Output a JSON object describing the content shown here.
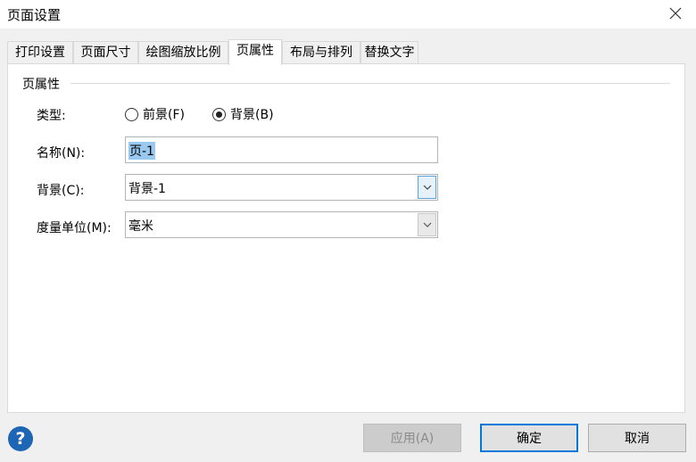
{
  "window": {
    "title": "页面设置"
  },
  "tabs": [
    {
      "label": "打印设置"
    },
    {
      "label": "页面尺寸"
    },
    {
      "label": "绘图缩放比例"
    },
    {
      "label": "页属性",
      "active": true
    },
    {
      "label": "布局与排列"
    },
    {
      "label": "替换文字"
    }
  ],
  "page_props": {
    "group_title": "页属性",
    "type": {
      "label": "类型:",
      "options": [
        {
          "label": "前景(F)",
          "selected": false
        },
        {
          "label": "背景(B)",
          "selected": true
        }
      ]
    },
    "name": {
      "label": "名称(N):",
      "value": "页-1"
    },
    "background": {
      "label": "背景(C):",
      "value": "背景-1"
    },
    "measurement_units": {
      "label": "度量单位(M):",
      "value": "毫米"
    }
  },
  "footer": {
    "help_icon": "help-icon",
    "apply_label": "应用(A)",
    "ok_label": "确定",
    "cancel_label": "取消"
  },
  "colors": {
    "accent": "#0078d7",
    "help_icon": "#1d65b5",
    "selection": "#99c9ef"
  }
}
